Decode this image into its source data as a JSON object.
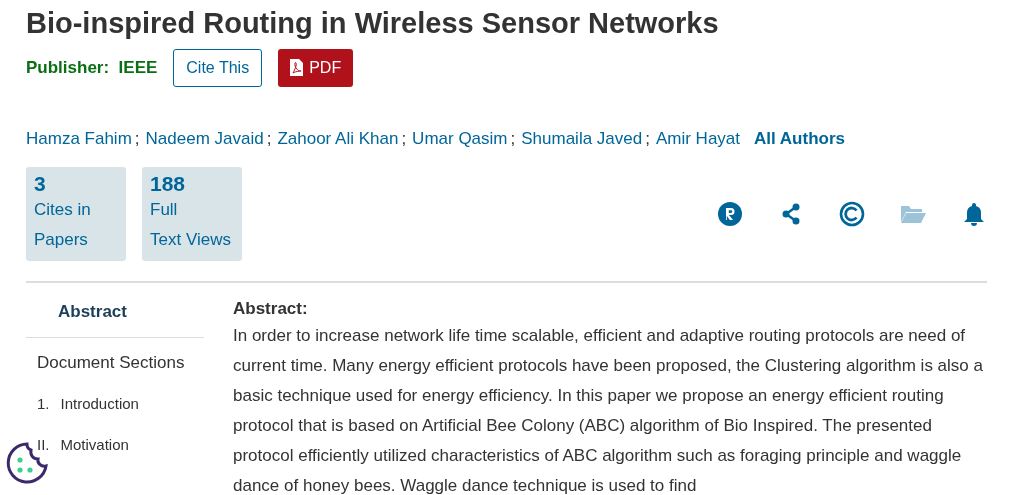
{
  "title": "Bio-inspired Routing in Wireless Sensor Networks",
  "publisher": {
    "label": "Publisher:",
    "name": "IEEE"
  },
  "buttons": [
    {
      "label": "Cite This",
      "kind": "outline"
    },
    {
      "label": "PDF",
      "kind": "pdf"
    }
  ],
  "authors": [
    "Hamza Fahim",
    "Nadeem Javaid",
    "Zahoor Ali Khan",
    "Umar Qasim",
    "Shumaila Javed",
    "Amir Hayat"
  ],
  "author_separator": ";",
  "all_authors": "All Authors",
  "metrics": [
    {
      "count": "3",
      "lines": [
        "Cites in",
        "Papers"
      ]
    },
    {
      "count": "188",
      "lines": [
        "Full",
        "Text Views"
      ]
    }
  ],
  "action_icons": [
    {
      "kind": "rights",
      "disabled": false
    },
    {
      "kind": "share",
      "disabled": false
    },
    {
      "kind": "copyright",
      "disabled": false
    },
    {
      "kind": "folder",
      "disabled": true
    },
    {
      "kind": "alert",
      "disabled": false
    }
  ],
  "sidebar": {
    "active": "Abstract",
    "heading": "Document Sections",
    "sections": [
      {
        "number": "1.",
        "title": "Introduction"
      },
      {
        "number": "II.",
        "title": "Motivation"
      }
    ]
  },
  "abstract": {
    "heading": "Abstract:",
    "text": "In order to increase network life time scalable, efficient and adaptive routing protocols are need of current time. Many energy efficient protocols have been proposed, the Clustering algorithm is also a basic technique used for energy efficiency. In this paper we propose an energy efficient routing protocol that is based on Artificial Bee Colony (ABC) algorithm of Bio Inspired. The presented protocol efficiently utilized characteristics of ABC algorithm such as foraging principle and waggle dance of honey bees. Waggle dance technique is used to find"
  }
}
